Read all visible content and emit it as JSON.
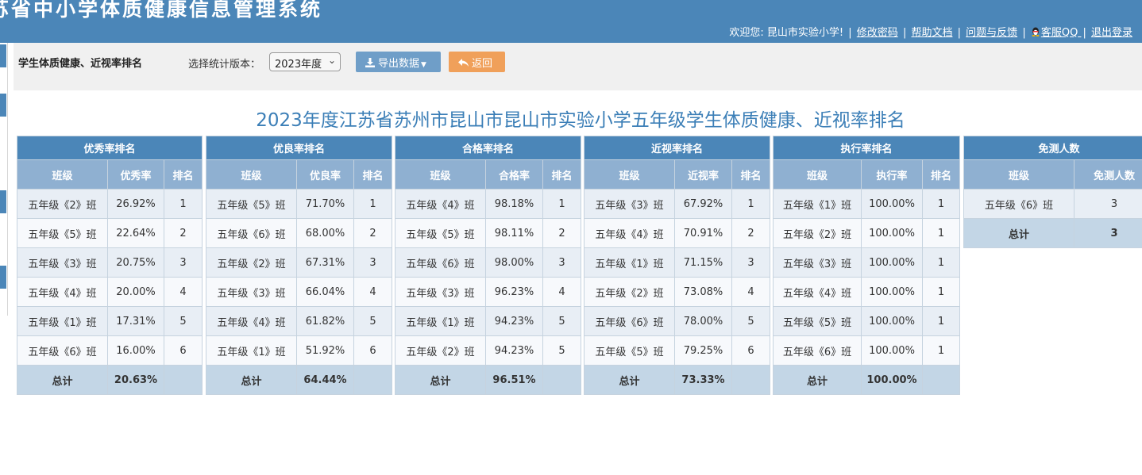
{
  "header": {
    "system_title": "苏省中小学体质健康信息管理系统",
    "welcome": "欢迎您: 昆山市实验小学!",
    "links": {
      "change_password": "修改密码",
      "help_docs": "帮助文档",
      "feedback": "问题与反馈",
      "qq_service": "客服QQ",
      "logout": "退出登录"
    },
    "separator": "|"
  },
  "toolbar": {
    "page_label": "学生体质健康、近视率排名",
    "version_label": "选择统计版本：",
    "version_selected": "2023年度",
    "export_label": "导出数据",
    "back_label": "返回"
  },
  "report_title": "2023年度江苏省苏州市昆山市昆山市实验小学五年级学生体质健康、近视率排名",
  "tables": [
    {
      "caption": "优秀率排名",
      "headers": [
        "班级",
        "优秀率",
        "排名"
      ],
      "rows": [
        [
          "五年级《2》班",
          "26.92%",
          "1"
        ],
        [
          "五年级《5》班",
          "22.64%",
          "2"
        ],
        [
          "五年级《3》班",
          "20.75%",
          "3"
        ],
        [
          "五年级《4》班",
          "20.00%",
          "4"
        ],
        [
          "五年级《1》班",
          "17.31%",
          "5"
        ],
        [
          "五年级《6》班",
          "16.00%",
          "6"
        ]
      ],
      "total": [
        "总计",
        "20.63%",
        ""
      ]
    },
    {
      "caption": "优良率排名",
      "headers": [
        "班级",
        "优良率",
        "排名"
      ],
      "rows": [
        [
          "五年级《5》班",
          "71.70%",
          "1"
        ],
        [
          "五年级《6》班",
          "68.00%",
          "2"
        ],
        [
          "五年级《2》班",
          "67.31%",
          "3"
        ],
        [
          "五年级《3》班",
          "66.04%",
          "4"
        ],
        [
          "五年级《4》班",
          "61.82%",
          "5"
        ],
        [
          "五年级《1》班",
          "51.92%",
          "6"
        ]
      ],
      "total": [
        "总计",
        "64.44%",
        ""
      ]
    },
    {
      "caption": "合格率排名",
      "headers": [
        "班级",
        "合格率",
        "排名"
      ],
      "rows": [
        [
          "五年级《4》班",
          "98.18%",
          "1"
        ],
        [
          "五年级《5》班",
          "98.11%",
          "2"
        ],
        [
          "五年级《6》班",
          "98.00%",
          "3"
        ],
        [
          "五年级《3》班",
          "96.23%",
          "4"
        ],
        [
          "五年级《1》班",
          "94.23%",
          "5"
        ],
        [
          "五年级《2》班",
          "94.23%",
          "5"
        ]
      ],
      "total": [
        "总计",
        "96.51%",
        ""
      ]
    },
    {
      "caption": "近视率排名",
      "headers": [
        "班级",
        "近视率",
        "排名"
      ],
      "rows": [
        [
          "五年级《3》班",
          "67.92%",
          "1"
        ],
        [
          "五年级《4》班",
          "70.91%",
          "2"
        ],
        [
          "五年级《1》班",
          "71.15%",
          "3"
        ],
        [
          "五年级《2》班",
          "73.08%",
          "4"
        ],
        [
          "五年级《6》班",
          "78.00%",
          "5"
        ],
        [
          "五年级《5》班",
          "79.25%",
          "6"
        ]
      ],
      "total": [
        "总计",
        "73.33%",
        ""
      ]
    },
    {
      "caption": "执行率排名",
      "headers": [
        "班级",
        "执行率",
        "排名"
      ],
      "rows": [
        [
          "五年级《1》班",
          "100.00%",
          "1"
        ],
        [
          "五年级《2》班",
          "100.00%",
          "1"
        ],
        [
          "五年级《3》班",
          "100.00%",
          "1"
        ],
        [
          "五年级《4》班",
          "100.00%",
          "1"
        ],
        [
          "五年级《5》班",
          "100.00%",
          "1"
        ],
        [
          "五年级《6》班",
          "100.00%",
          "1"
        ]
      ],
      "total": [
        "总计",
        "100.00%",
        ""
      ]
    }
  ],
  "exempt_table": {
    "caption": "免测人数",
    "headers": [
      "班级",
      "免测人数"
    ],
    "rows": [
      [
        "五年级《6》班",
        "3"
      ]
    ],
    "total": [
      "总计",
      "3"
    ]
  },
  "colors": {
    "header_bg": "#4b86b8",
    "subheader_bg": "#8fb0d1",
    "total_bg": "#c3d6e6",
    "title_color": "#3c7fb7",
    "export_button": "#6f9ec8",
    "back_button": "#f0a05a"
  },
  "icons": {
    "export": "download-icon",
    "back": "back-arrow-icon",
    "qq": "qq-penguin-icon"
  }
}
